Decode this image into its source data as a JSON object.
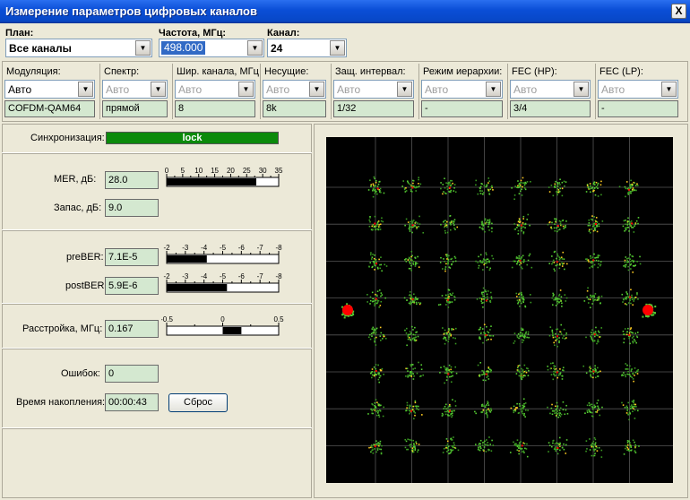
{
  "window": {
    "title": "Измерение параметров цифровых каналов",
    "close_glyph": "X"
  },
  "top": {
    "plan": {
      "label": "План:",
      "value": "Все каналы"
    },
    "freq": {
      "label": "Частота, МГц:",
      "value": "498.000"
    },
    "channel": {
      "label": "Канал:",
      "value": "24"
    }
  },
  "params": [
    {
      "label": "Модуляция:",
      "select": "Авто",
      "enabled": true,
      "value": "COFDM-QAM64"
    },
    {
      "label": "Спектр:",
      "select": "Авто",
      "enabled": false,
      "value": "прямой"
    },
    {
      "label": "Шир. канала, МГц",
      "select": "Авто",
      "enabled": false,
      "value": "8"
    },
    {
      "label": "Несущие:",
      "select": "Авто",
      "enabled": false,
      "value": "8k"
    },
    {
      "label": "Защ. интервал:",
      "select": "Авто",
      "enabled": false,
      "value": "1/32"
    },
    {
      "label": "Режим иерархии:",
      "select": "Авто",
      "enabled": false,
      "value": "-"
    },
    {
      "label": "FEC (HP):",
      "select": "Авто",
      "enabled": false,
      "value": "3/4"
    },
    {
      "label": "FEC (LP):",
      "select": "Авто",
      "enabled": false,
      "value": "-"
    }
  ],
  "sync": {
    "label": "Синхронизация:",
    "status": "lock",
    "status_color": "#0b8a0b"
  },
  "mer": {
    "label": "MER, дБ:",
    "value": "28.0",
    "scale": [
      "0",
      "5",
      "10",
      "15",
      "20",
      "25",
      "30",
      "35"
    ],
    "level_db": 28.0,
    "range": [
      0,
      35
    ]
  },
  "margin": {
    "label": "Запас, дБ:",
    "value": "9.0"
  },
  "preber": {
    "label": "preBER:",
    "value": "7.1E-5",
    "scale": [
      "-2",
      "-3",
      "-4",
      "-5",
      "-6",
      "-7",
      "-8"
    ],
    "log_level": -4.15,
    "range": [
      -2,
      -8
    ]
  },
  "postber": {
    "label": "postBER:",
    "value": "5.9E-6",
    "scale": [
      "-2",
      "-3",
      "-4",
      "-5",
      "-6",
      "-7",
      "-8"
    ],
    "log_level": -5.23,
    "range": [
      -2,
      -8
    ]
  },
  "detune": {
    "label": "Расстройка, МГц:",
    "value": "0.167",
    "scale": [
      "-0.5",
      "0",
      "0.5"
    ],
    "offset_mhz": 0.167,
    "range": [
      -0.5,
      0.5
    ]
  },
  "errors": {
    "label": "Ошибок:",
    "value": "0"
  },
  "accum": {
    "label": "Время накопления:",
    "value": "00:00:43"
  },
  "reset_button": {
    "label": "Сброс"
  },
  "constellation": {
    "grid": "8x8",
    "pilot_color": "#ff0000",
    "point_color": "#55cc33",
    "background": "#000000"
  }
}
